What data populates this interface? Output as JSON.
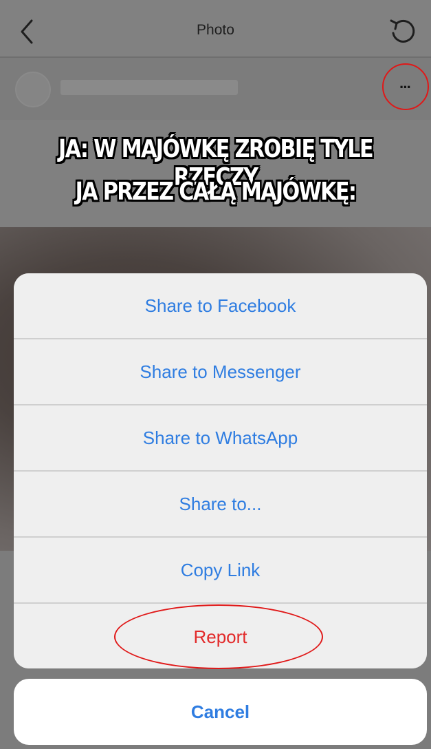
{
  "navbar": {
    "title": "Photo",
    "back_icon": "chevron-left-icon",
    "refresh_icon": "refresh-icon"
  },
  "post": {
    "more_label": "···"
  },
  "meme": {
    "line1": "JA: W MAJÓWKĘ ZROBIĘ TYLE RZECZY",
    "line2": "JA PRZEZ CAŁĄ MAJÓWKĘ:"
  },
  "action_sheet": {
    "items": [
      {
        "label": "Share to Facebook"
      },
      {
        "label": "Share to Messenger"
      },
      {
        "label": "Share to WhatsApp"
      },
      {
        "label": "Share to..."
      },
      {
        "label": "Copy Link"
      },
      {
        "label": "Report"
      }
    ],
    "cancel_label": "Cancel"
  },
  "colors": {
    "accent": "#2f7de1",
    "danger": "#e22a2a",
    "highlight_circle": "#e01818"
  }
}
